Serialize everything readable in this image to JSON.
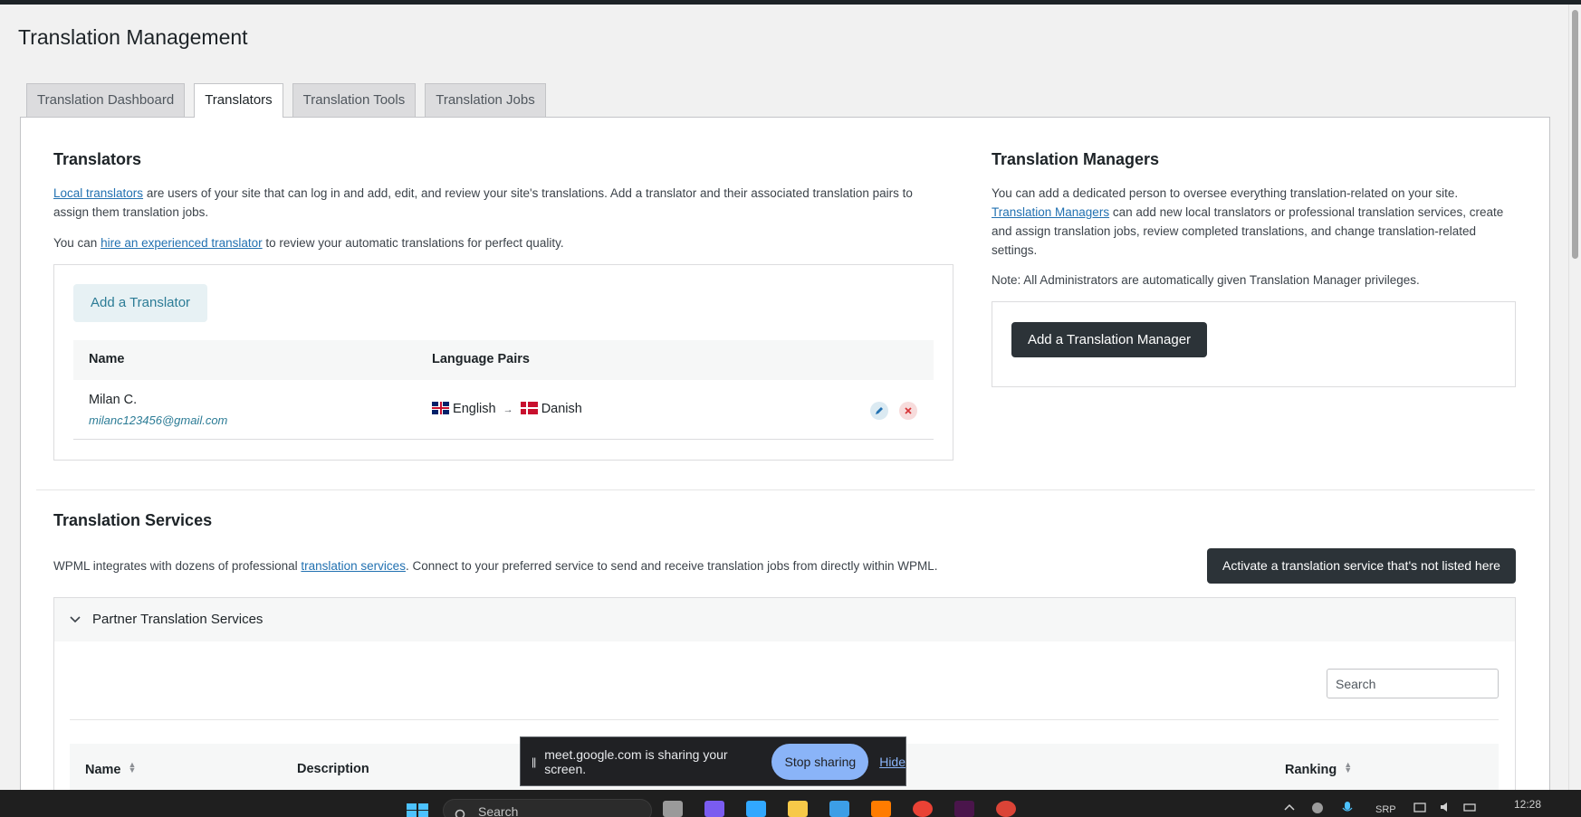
{
  "page": {
    "title": "Translation Management"
  },
  "tabs": [
    {
      "label": "Translation Dashboard",
      "active": false
    },
    {
      "label": "Translators",
      "active": true
    },
    {
      "label": "Translation Tools",
      "active": false
    },
    {
      "label": "Translation Jobs",
      "active": false
    }
  ],
  "translators": {
    "heading": "Translators",
    "intro_link": "Local translators",
    "intro_text": " are users of your site that can log in and add, edit, and review your site's translations. Add a translator and their associated translation pairs to assign them translation jobs.",
    "hire_prefix": "You can ",
    "hire_link": "hire an experienced translator",
    "hire_suffix": " to review your automatic translations for perfect quality.",
    "add_button": "Add a Translator",
    "columns": {
      "name": "Name",
      "pairs": "Language Pairs"
    },
    "rows": [
      {
        "name": "Milan C.",
        "email": "milanc123456@gmail.com",
        "from": "English",
        "arrow": "→",
        "to": "Danish"
      }
    ]
  },
  "managers": {
    "heading": "Translation Managers",
    "line1": "You can add a dedicated person to oversee everything translation-related on your site.",
    "link": "Translation Managers",
    "line2": " can add new local translators or professional translation services, create and assign translation jobs, review completed translations, and change translation-related settings.",
    "note": "Note: All Administrators are automatically given Translation Manager privileges.",
    "add_button": "Add a Translation Manager"
  },
  "services": {
    "heading": "Translation Services",
    "desc_prefix": "WPML integrates with dozens of professional ",
    "desc_link": "translation services",
    "desc_suffix": ". Connect to your preferred service to send and receive translation jobs from directly within WPML.",
    "activate_button": "Activate a translation service that's not listed here",
    "partner_label": "Partner Translation Services",
    "search_placeholder": "Search",
    "columns": {
      "name": "Name",
      "description": "Description",
      "ranking": "Ranking"
    }
  },
  "share_bar": {
    "pause": "||",
    "message": "meet.google.com is sharing your screen.",
    "stop": "Stop sharing",
    "hide": "Hide"
  },
  "taskbar": {
    "search": "Search",
    "lang": "SRP",
    "time": "12:28"
  },
  "colors": {
    "accent": "#2271b1",
    "dark_button": "#2c3338",
    "light_button": "#e7f1f4"
  }
}
